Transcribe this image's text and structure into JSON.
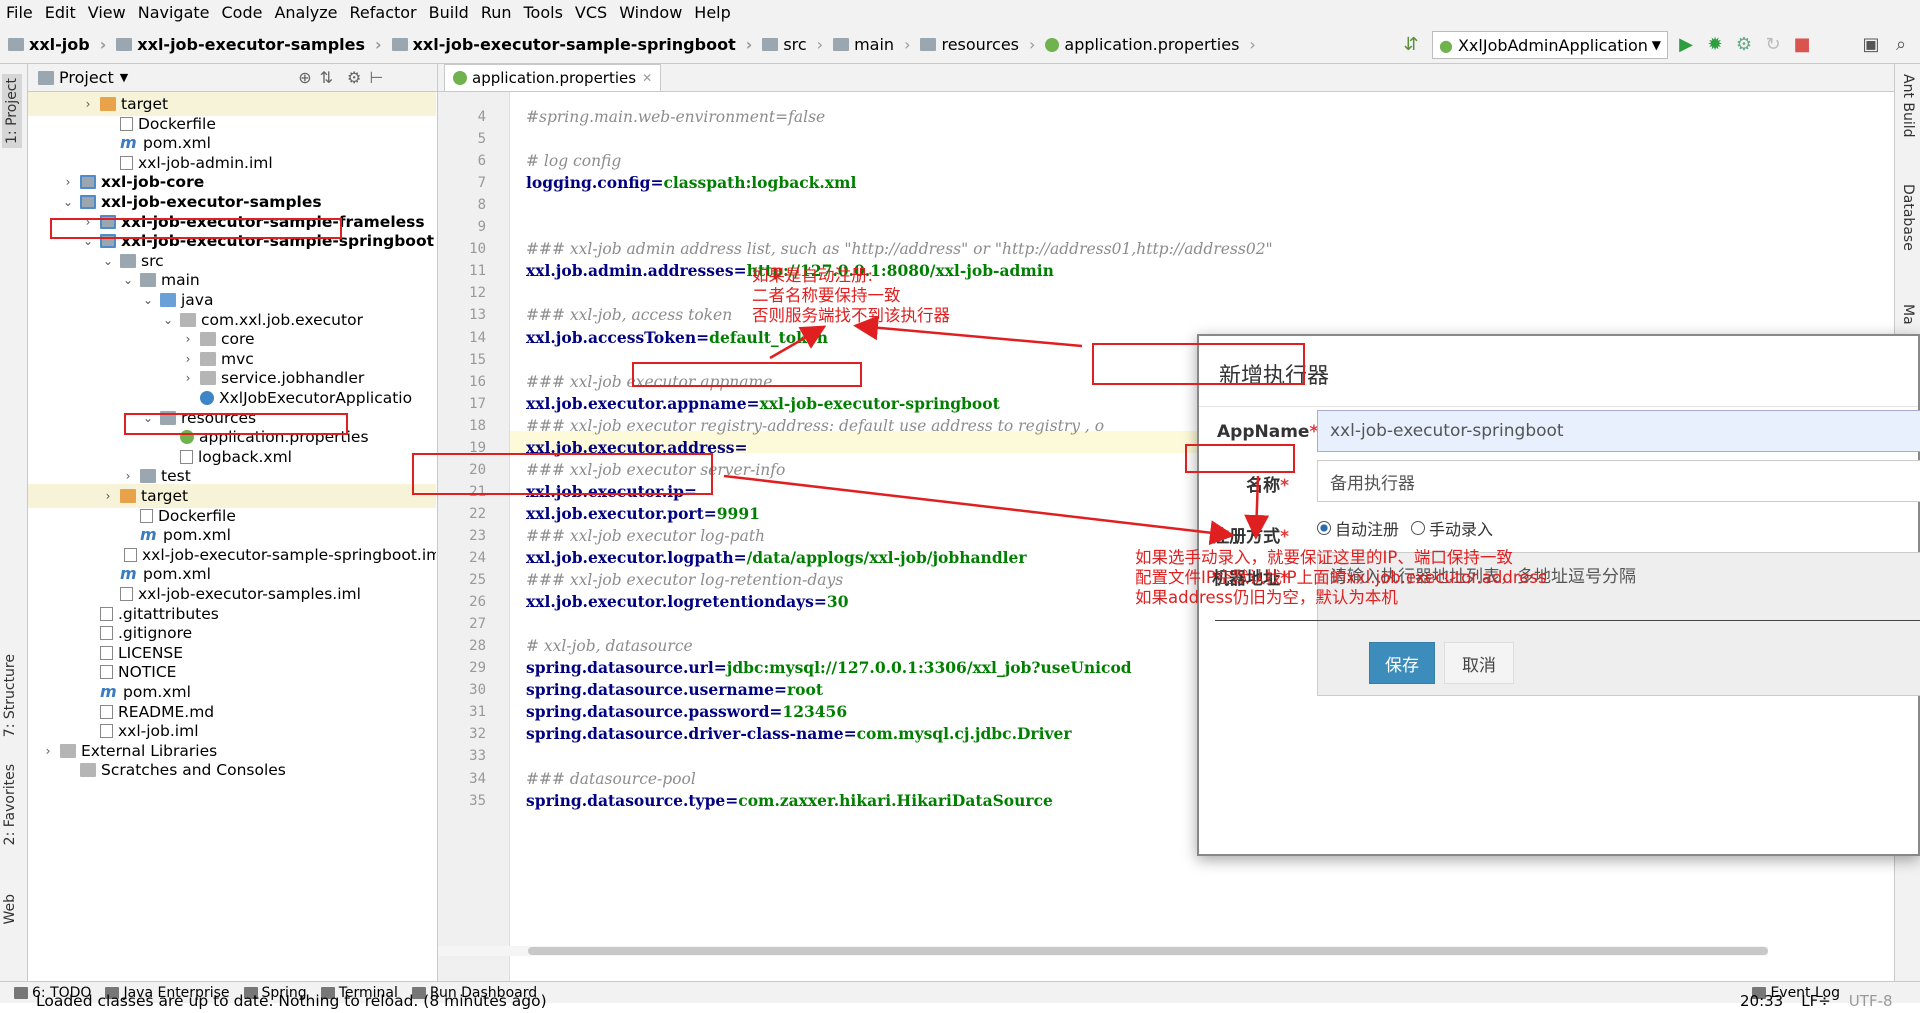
{
  "menu": [
    "File",
    "Edit",
    "View",
    "Navigate",
    "Code",
    "Analyze",
    "Refactor",
    "Build",
    "Run",
    "Tools",
    "VCS",
    "Window",
    "Help"
  ],
  "breadcrumbs": [
    "xxl-job",
    "xxl-job-executor-samples",
    "xxl-job-executor-sample-springboot",
    "src",
    "main",
    "resources",
    "application.properties"
  ],
  "run_config": "XxlJobAdminApplication",
  "left_tabs": {
    "project": "1: Project",
    "structure": "7: Structure",
    "favorites": "2: Favorites",
    "web": "Web"
  },
  "right_tabs": {
    "ant": "Ant Build",
    "database": "Database",
    "maven": "Ma"
  },
  "project_panel": {
    "title": "Project"
  },
  "tree": [
    {
      "label": "target",
      "indent": 2,
      "arrow": ">",
      "icon": "ofolder",
      "hl": true,
      "bold": false
    },
    {
      "label": "Dockerfile",
      "indent": 3,
      "arrow": "",
      "icon": "file",
      "hl": false,
      "bold": false
    },
    {
      "label": "pom.xml",
      "indent": 3,
      "arrow": "",
      "icon": "m",
      "hl": false,
      "bold": false
    },
    {
      "label": "xxl-job-admin.iml",
      "indent": 3,
      "arrow": "",
      "icon": "file",
      "hl": false,
      "bold": false
    },
    {
      "label": "xxl-job-core",
      "indent": 1,
      "arrow": ">",
      "icon": "mod",
      "hl": false,
      "bold": true
    },
    {
      "label": "xxl-job-executor-samples",
      "indent": 1,
      "arrow": "v",
      "icon": "mod",
      "hl": false,
      "bold": true
    },
    {
      "label": "xxl-job-executor-sample-frameless",
      "indent": 2,
      "arrow": ">",
      "icon": "mod",
      "hl": false,
      "bold": true
    },
    {
      "label": "xxl-job-executor-sample-springboot",
      "indent": 2,
      "arrow": "v",
      "icon": "mod",
      "hl": false,
      "bold": true
    },
    {
      "label": "src",
      "indent": 3,
      "arrow": "v",
      "icon": "folder",
      "hl": false,
      "bold": false
    },
    {
      "label": "main",
      "indent": 4,
      "arrow": "v",
      "icon": "folder",
      "hl": false,
      "bold": false
    },
    {
      "label": "java",
      "indent": 5,
      "arrow": "v",
      "icon": "src",
      "hl": false,
      "bold": false
    },
    {
      "label": "com.xxl.job.executor",
      "indent": 6,
      "arrow": "v",
      "icon": "pkg",
      "hl": false,
      "bold": false
    },
    {
      "label": "core",
      "indent": 7,
      "arrow": ">",
      "icon": "pkg",
      "hl": false,
      "bold": false
    },
    {
      "label": "mvc",
      "indent": 7,
      "arrow": ">",
      "icon": "pkg",
      "hl": false,
      "bold": false
    },
    {
      "label": "service.jobhandler",
      "indent": 7,
      "arrow": ">",
      "icon": "pkg",
      "hl": false,
      "bold": false
    },
    {
      "label": "XxlJobExecutorApplicatio",
      "indent": 7,
      "arrow": "",
      "icon": "class",
      "hl": false,
      "bold": false
    },
    {
      "label": "resources",
      "indent": 5,
      "arrow": "v",
      "icon": "folder",
      "hl": false,
      "bold": false
    },
    {
      "label": "application.properties",
      "indent": 6,
      "arrow": "",
      "icon": "leaf",
      "hl": false,
      "bold": false
    },
    {
      "label": "logback.xml",
      "indent": 6,
      "arrow": "",
      "icon": "file",
      "hl": false,
      "bold": false
    },
    {
      "label": "test",
      "indent": 4,
      "arrow": ">",
      "icon": "folder",
      "hl": false,
      "bold": false
    },
    {
      "label": "target",
      "indent": 3,
      "arrow": ">",
      "icon": "ofolder",
      "hl": true,
      "bold": false
    },
    {
      "label": "Dockerfile",
      "indent": 4,
      "arrow": "",
      "icon": "file",
      "hl": false,
      "bold": false
    },
    {
      "label": "pom.xml",
      "indent": 4,
      "arrow": "",
      "icon": "m",
      "hl": false,
      "bold": false
    },
    {
      "label": "xxl-job-executor-sample-springboot.im",
      "indent": 4,
      "arrow": "",
      "icon": "file",
      "hl": false,
      "bold": false
    },
    {
      "label": "pom.xml",
      "indent": 3,
      "arrow": "",
      "icon": "m",
      "hl": false,
      "bold": false
    },
    {
      "label": "xxl-job-executor-samples.iml",
      "indent": 3,
      "arrow": "",
      "icon": "file",
      "hl": false,
      "bold": false
    },
    {
      "label": ".gitattributes",
      "indent": 2,
      "arrow": "",
      "icon": "file",
      "hl": false,
      "bold": false
    },
    {
      "label": ".gitignore",
      "indent": 2,
      "arrow": "",
      "icon": "file",
      "hl": false,
      "bold": false
    },
    {
      "label": "LICENSE",
      "indent": 2,
      "arrow": "",
      "icon": "file",
      "hl": false,
      "bold": false
    },
    {
      "label": "NOTICE",
      "indent": 2,
      "arrow": "",
      "icon": "file",
      "hl": false,
      "bold": false
    },
    {
      "label": "pom.xml",
      "indent": 2,
      "arrow": "",
      "icon": "m",
      "hl": false,
      "bold": false
    },
    {
      "label": "README.md",
      "indent": 2,
      "arrow": "",
      "icon": "file",
      "hl": false,
      "bold": false
    },
    {
      "label": "xxl-job.iml",
      "indent": 2,
      "arrow": "",
      "icon": "file",
      "hl": false,
      "bold": false
    },
    {
      "label": "External Libraries",
      "indent": 0,
      "arrow": ">",
      "icon": "pkg",
      "hl": false,
      "bold": false
    },
    {
      "label": "Scratches and Consoles",
      "indent": 1,
      "arrow": "",
      "icon": "pkg",
      "hl": false,
      "bold": false
    }
  ],
  "editor_tab": "application.properties",
  "code": [
    {
      "n": "4",
      "t": "cmt",
      "a": "#spring.main.web-environment=false",
      "b": ""
    },
    {
      "n": "5",
      "t": "blank",
      "a": "",
      "b": ""
    },
    {
      "n": "6",
      "t": "cmt",
      "a": "# log config",
      "b": ""
    },
    {
      "n": "7",
      "t": "kv",
      "a": "logging.config=",
      "b": "classpath:logback.xml"
    },
    {
      "n": "8",
      "t": "blank",
      "a": "",
      "b": ""
    },
    {
      "n": "9",
      "t": "blank",
      "a": "",
      "b": ""
    },
    {
      "n": "10",
      "t": "cmt",
      "a": "### xxl-job admin address list, such as \"http://address\" or \"http://address01,http://address02\"",
      "b": ""
    },
    {
      "n": "11",
      "t": "kv",
      "a": "xxl.job.admin.addresses=",
      "b": "http://127.0.0.1:8080/xxl-job-admin"
    },
    {
      "n": "12",
      "t": "blank",
      "a": "",
      "b": ""
    },
    {
      "n": "13",
      "t": "cmt",
      "a": "### xxl-job, access token",
      "b": ""
    },
    {
      "n": "14",
      "t": "kv",
      "a": "xxl.job.accessToken=",
      "b": "default_token"
    },
    {
      "n": "15",
      "t": "blank",
      "a": "",
      "b": ""
    },
    {
      "n": "16",
      "t": "cmt",
      "a": "### xxl-job executor appname",
      "b": ""
    },
    {
      "n": "17",
      "t": "kv",
      "a": "xxl.job.executor.appname=",
      "b": "xxl-job-executor-springboot"
    },
    {
      "n": "18",
      "t": "cmt",
      "a": "### xxl-job executor registry-address: default use address to registry , o",
      "b": ""
    },
    {
      "n": "19",
      "t": "kv",
      "a": "xxl.job.executor.address=",
      "b": ""
    },
    {
      "n": "20",
      "t": "cmt",
      "a": "### xxl-job executor server-info",
      "b": ""
    },
    {
      "n": "21",
      "t": "kv",
      "a": "xxl.job.executor.ip=",
      "b": ""
    },
    {
      "n": "22",
      "t": "kv",
      "a": "xxl.job.executor.port=",
      "b": "9991"
    },
    {
      "n": "23",
      "t": "cmt",
      "a": "### xxl-job executor log-path",
      "b": ""
    },
    {
      "n": "24",
      "t": "kv",
      "a": "xxl.job.executor.logpath=",
      "b": "/data/applogs/xxl-job/jobhandler"
    },
    {
      "n": "25",
      "t": "cmt",
      "a": "### xxl-job executor log-retention-days",
      "b": ""
    },
    {
      "n": "26",
      "t": "kv",
      "a": "xxl.job.executor.logretentiondays=",
      "b": "30"
    },
    {
      "n": "27",
      "t": "blank",
      "a": "",
      "b": ""
    },
    {
      "n": "28",
      "t": "cmt",
      "a": "# xxl-job, datasource",
      "b": ""
    },
    {
      "n": "29",
      "t": "kv",
      "a": "spring.datasource.url=",
      "b": "jdbc:mysql://127.0.0.1:3306/xxl_job?useUnicod"
    },
    {
      "n": "30",
      "t": "kv",
      "a": "spring.datasource.username=",
      "b": "root"
    },
    {
      "n": "31",
      "t": "kv",
      "a": "spring.datasource.password=",
      "b": "123456"
    },
    {
      "n": "32",
      "t": "kv",
      "a": "spring.datasource.driver-class-name=",
      "b": "com.mysql.cj.jdbc.Driver"
    },
    {
      "n": "33",
      "t": "blank",
      "a": "",
      "b": ""
    },
    {
      "n": "34",
      "t": "cmt",
      "a": "### datasource-pool",
      "b": ""
    },
    {
      "n": "35",
      "t": "kv",
      "a": "spring.datasource.type=",
      "b": "com.zaxxer.hikari.HikariDataSource"
    }
  ],
  "dialog": {
    "title": "新增执行器",
    "appname_label": "AppName",
    "appname_value": "xxl-job-executor-springboot",
    "name_label": "名称",
    "name_placeholder": "备用执行器",
    "reg_label": "注册方式",
    "reg_auto": "自动注册",
    "reg_manual": "手动录入",
    "addr_label": "机器地址",
    "addr_placeholder": "请输入执行器地址列表，多地址逗号分隔",
    "required_mark": "*",
    "save": "保存",
    "cancel": "取消"
  },
  "annotations": {
    "note1": [
      "如果是自动注册:",
      "二者名称要保持一致",
      "否则服务端找不到该执行器"
    ],
    "note2": [
      "如果选手动录入，就要保证这里的IP、端口保持一致",
      "配置文件IP空默认找IP上面的xxl.job.executor.address",
      "如果address仍旧为空，默认为本机"
    ],
    "color": "#e02020"
  },
  "bottom_tools": [
    "6: TODO",
    "Java Enterprise",
    "Spring",
    "Terminal",
    "Run Dashboard",
    "Event Log"
  ],
  "status": {
    "message": "Loaded classes are up to date. Nothing to reload. (8 minutes ago)",
    "position": "20:33",
    "line_sep": "LF÷",
    "encoding": "UTF-8"
  },
  "colors": {
    "accent": "#3c8dbc",
    "key": "#000080",
    "value": "#007f00",
    "comment": "#8c8c8c"
  }
}
